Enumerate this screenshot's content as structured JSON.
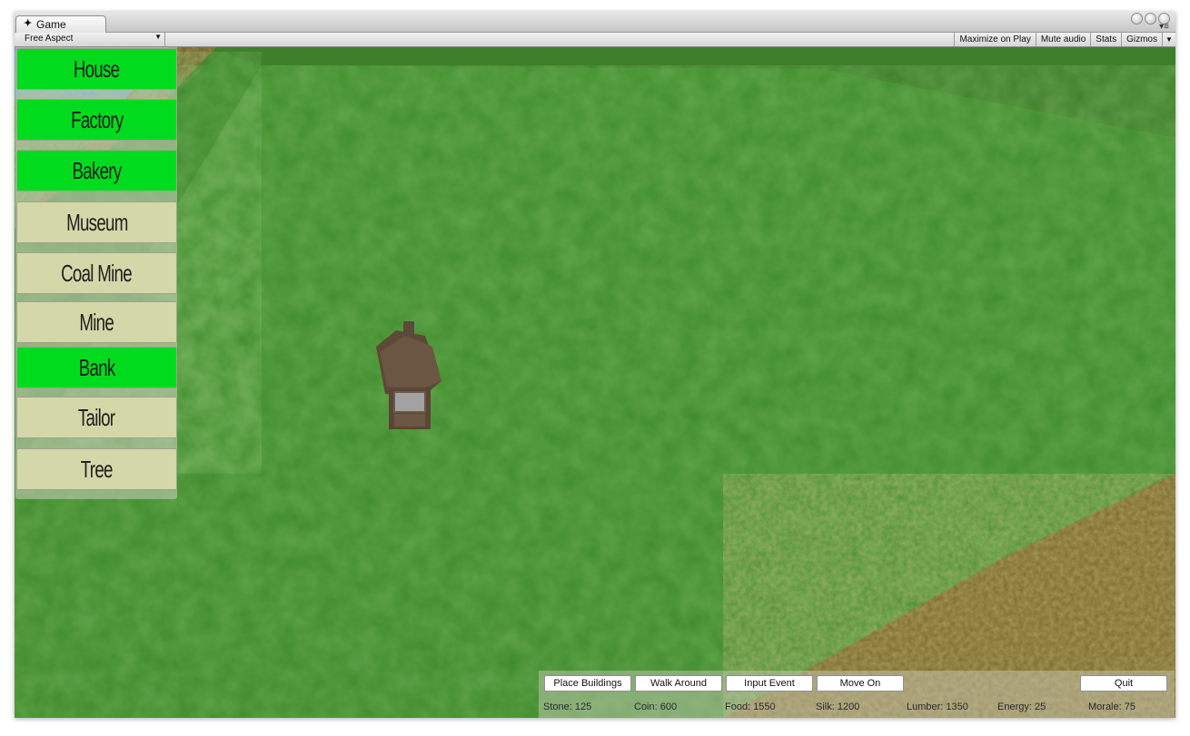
{
  "window": {
    "tab_label": "Game",
    "tab_icon": "unity-icon"
  },
  "toolbar": {
    "aspect_label": "Free Aspect",
    "maximize_label": "Maximize on Play",
    "mute_label": "Mute audio",
    "stats_label": "Stats",
    "gizmos_label": "Gizmos"
  },
  "buildings": [
    {
      "label": "House",
      "state": "active"
    },
    {
      "label": "Factory",
      "state": "active"
    },
    {
      "label": "Bakery",
      "state": "active"
    },
    {
      "label": "Museum",
      "state": "inactive"
    },
    {
      "label": "Coal Mine",
      "state": "inactive"
    },
    {
      "label": "Mine",
      "state": "inactive"
    },
    {
      "label": "Bank",
      "state": "active"
    },
    {
      "label": "Tailor",
      "state": "inactive"
    },
    {
      "label": "Tree",
      "state": "inactive"
    }
  ],
  "modes": {
    "place": "Place Buildings",
    "walk": "Walk Around",
    "input": "Input Event",
    "move": "Move On",
    "quit": "Quit"
  },
  "resources": {
    "stone": "Stone: 125",
    "coin": "Coin: 600",
    "food": "Food: 1550",
    "silk": "Silk: 1200",
    "lumber": "Lumber: 1350",
    "energy": "Energy: 25",
    "morale": "Morale: 75"
  },
  "colors": {
    "active_button": "#00dc1d",
    "inactive_button": "#d4d8a9",
    "grass": "#3f8a2c",
    "dirt": "#6e5a24",
    "sky": "#3d8fe6"
  }
}
